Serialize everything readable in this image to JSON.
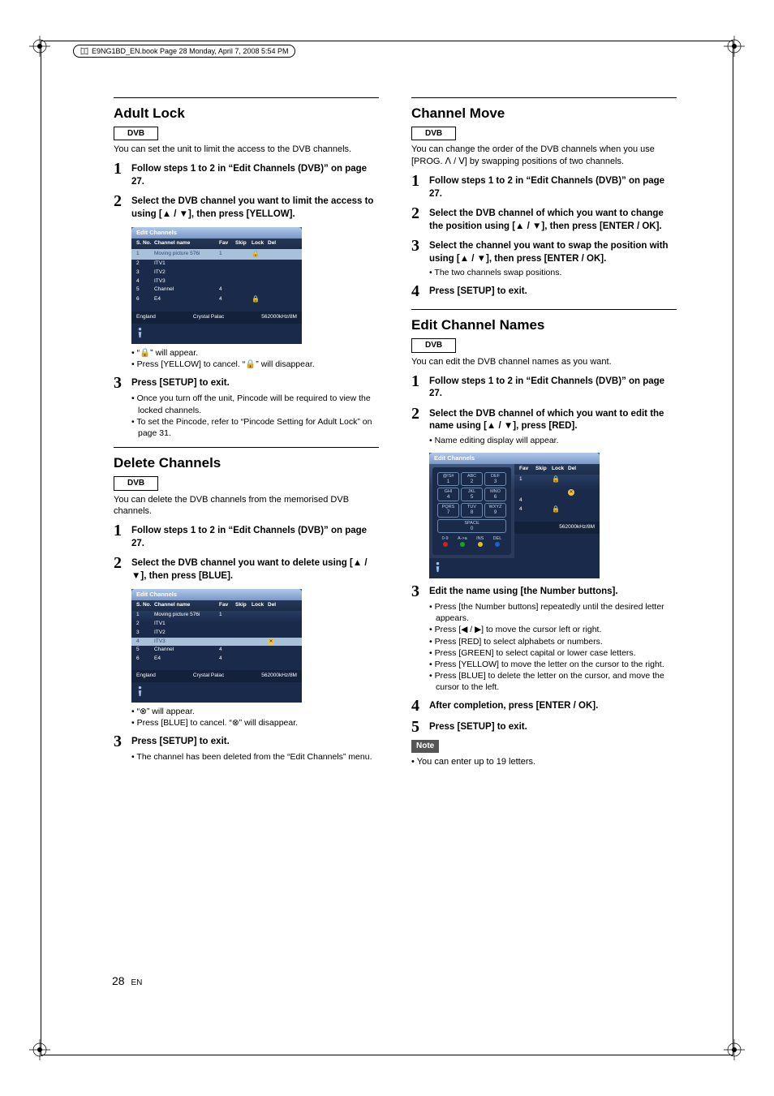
{
  "book_header": {
    "text": "E9NG1BD_EN.book  Page 28  Monday, April 7, 2008  5:54 PM"
  },
  "page_number": "28",
  "page_lang": "EN",
  "dvb_label": "DVB",
  "note_label": "Note",
  "left_col": {
    "adult_lock": {
      "title": "Adult Lock",
      "intro": "You can set the unit to limit the access to the DVB channels.",
      "step1": "Follow steps 1 to 2 in “Edit Channels (DVB)” on page 27.",
      "step2": "Select the DVB channel you want to limit the access to using [▲ / ▼], then press [YELLOW].",
      "after_panel_b1": "• “🔒” will appear.",
      "after_panel_b2": "• Press [YELLOW] to cancel. “🔒” will disappear.",
      "step3": "Press [SETUP] to exit.",
      "step3_b1": "• Once you turn off the unit, Pincode will be required to view the locked channels.",
      "step3_b2": "• To set the Pincode, refer to “Pincode Setting for Adult Lock” on page 31."
    },
    "delete": {
      "title": "Delete Channels",
      "intro": "You can delete the DVB channels from the memorised DVB channels.",
      "step1": "Follow steps 1 to 2 in “Edit Channels (DVB)” on page 27.",
      "step2": "Select the DVB channel you want to delete using [▲ / ▼], then press [BLUE].",
      "after_panel_b1": "• “⊗” will appear.",
      "after_panel_b2": "• Press [BLUE] to cancel. “⊗” will disappear.",
      "step3": "Press [SETUP] to exit.",
      "step3_b1": "• The channel has been deleted from the “Edit Channels” menu."
    }
  },
  "right_col": {
    "move": {
      "title": "Channel Move",
      "intro": "You can change the order of the DVB channels when you use [PROG. ᐱ / ᐯ] by swapping positions of two channels.",
      "step1": "Follow steps 1 to 2 in “Edit Channels (DVB)” on page 27.",
      "step2": "Select the DVB channel of which you want to change the position using [▲ / ▼], then press [ENTER / OK].",
      "step3": "Select the channel you want to swap the position with using [▲ / ▼], then press [ENTER / OK].",
      "step3_b1": "• The two channels swap positions.",
      "step4": "Press [SETUP] to exit."
    },
    "edit_names": {
      "title": "Edit Channel Names",
      "intro": "You can edit the DVB channel names as you want.",
      "step1": "Follow steps 1 to 2 in “Edit Channels (DVB)” on page 27.",
      "step2": "Select the DVB channel of which you want to edit the name using [▲ / ▼], press [RED].",
      "step2_b1": "• Name editing display will appear.",
      "step3": "Edit the name using [the Number buttons].",
      "step3_b1": "• Press [the Number buttons] repeatedly until the desired letter appears.",
      "step3_b2": "• Press [◀ / ▶] to move the cursor left or right.",
      "step3_b3": "• Press [RED] to select alphabets or numbers.",
      "step3_b4": "• Press [GREEN] to select capital or lower case letters.",
      "step3_b5": "• Press [YELLOW] to move the letter on the cursor to the right.",
      "step3_b6": "• Press [BLUE] to delete the letter on the cursor, and move the cursor to the left.",
      "step4": "After completion, press [ENTER / OK].",
      "step5": "Press [SETUP] to exit.",
      "note1": "• You can enter up to 19 letters."
    }
  },
  "panel": {
    "title": "Edit Channels",
    "headers": {
      "sno": "S. No.",
      "name": "Channel name",
      "fav": "Fav",
      "skip": "Skip",
      "lock": "Lock",
      "del": "Del"
    },
    "rows": [
      {
        "sno": "1",
        "name": "Moving picture 576i",
        "fav": "1",
        "skip": "",
        "lock": "lock",
        "del": ""
      },
      {
        "sno": "2",
        "name": "ITV1"
      },
      {
        "sno": "3",
        "name": "ITV2"
      },
      {
        "sno": "4",
        "name": "ITV3"
      },
      {
        "sno": "5",
        "name": "Channel",
        "fav": "4"
      },
      {
        "sno": "6",
        "name": "E4",
        "fav": "4",
        "lock": "lock"
      }
    ],
    "footer": {
      "country": "England",
      "mux": "Crystal Palac",
      "freq": "562000kHz/8M"
    }
  },
  "panel_highlight_lock": 0,
  "panel_highlight_del": 3,
  "keypad": {
    "keys": [
      [
        "@!S#",
        "1"
      ],
      [
        "ABC",
        "2"
      ],
      [
        "DEF",
        "3"
      ],
      [
        "GHI",
        "4"
      ],
      [
        "JKL",
        "5"
      ],
      [
        "MNO",
        "6"
      ],
      [
        "PQRS",
        "7"
      ],
      [
        "TUV",
        "8"
      ],
      [
        "WXYZ",
        "9"
      ]
    ],
    "space": "SPACE",
    "zero": "0",
    "bottom": [
      "0-9",
      "A->a",
      "INS",
      "DEL"
    ],
    "dot_colors": [
      "#d02020",
      "#20a020",
      "#e0c020",
      "#2060c0"
    ]
  }
}
